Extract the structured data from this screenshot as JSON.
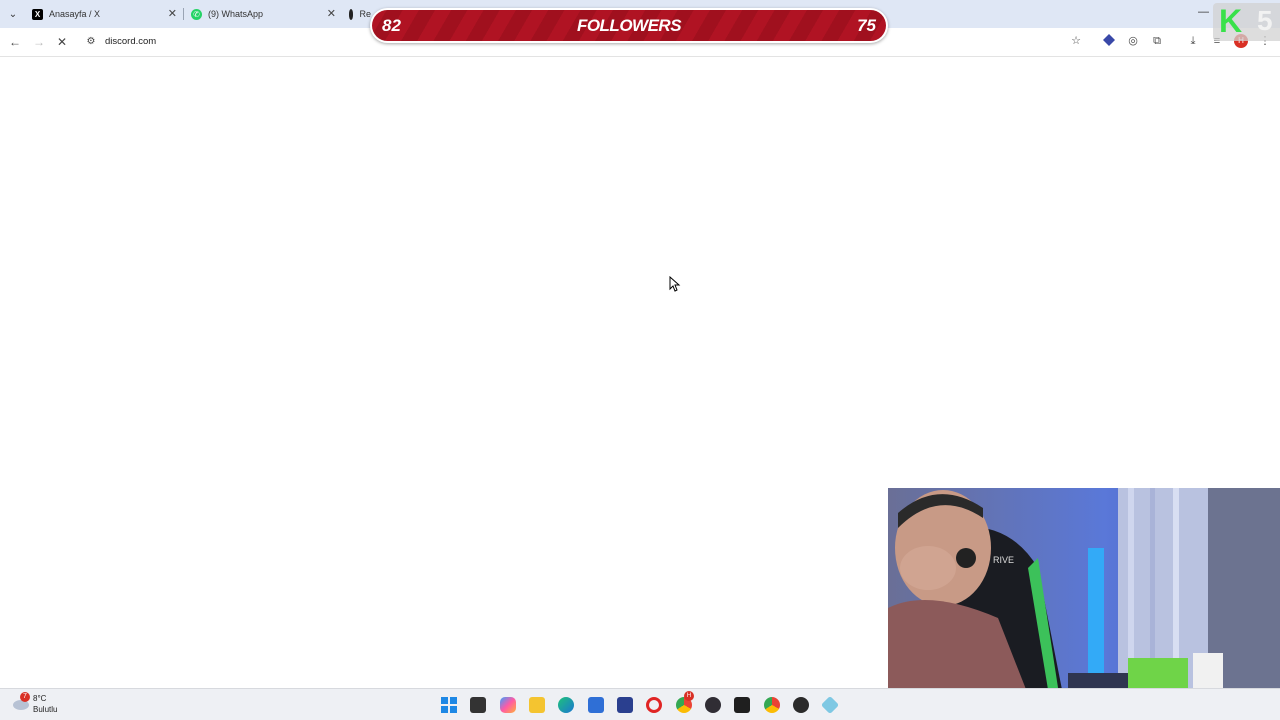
{
  "browser": {
    "tabs": [
      {
        "title": "Anasayfa / X",
        "icon": "x-logo-icon"
      },
      {
        "title": "(9) WhatsApp",
        "icon": "whatsapp-icon"
      },
      {
        "title": "Re",
        "icon": "github-icon"
      }
    ],
    "url": "discord.com",
    "profile_initial": "H"
  },
  "overlay": {
    "followers_left": "82",
    "followers_label": "FOLLOWERS",
    "followers_right": "75"
  },
  "logo": {
    "letter": "K",
    "number": "5"
  },
  "webcam": {
    "chair_text": "RIVE"
  },
  "taskbar": {
    "weather_badge": "7",
    "temperature": "8°C",
    "weather_desc": "Bulutlu",
    "chrome_badge": "H",
    "icons": [
      "windows-start-icon",
      "file-manager-icon",
      "copilot-icon",
      "folder-icon",
      "edge-icon",
      "store-icon",
      "tool-icon",
      "opera-icon",
      "chrome-icon",
      "obs-icon",
      "epic-games-icon",
      "chrome-alt-icon",
      "media-player-icon",
      "app-icon"
    ]
  },
  "colors": {
    "followers_bar": "#b01323",
    "logo_green": "#38e14a",
    "tabstrip": "#dfe7f5"
  }
}
